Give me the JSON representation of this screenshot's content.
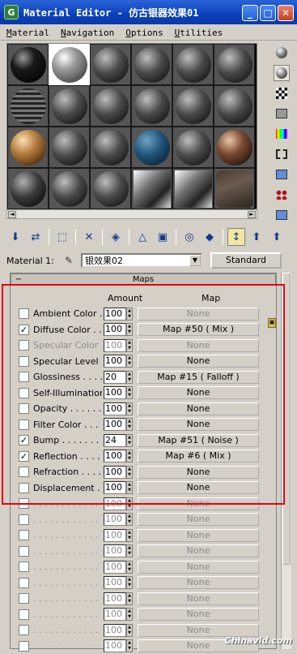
{
  "window": {
    "title": "Material Editor - 仿古银器效果01",
    "app_icon_letter": "G",
    "buttons": {
      "minimize": "_",
      "maximize": "□",
      "close": "✕"
    }
  },
  "menu": [
    "Material",
    "Navigation",
    "Options",
    "Utilities"
  ],
  "slots": [
    "black",
    "chrome",
    "metal",
    "metal",
    "metal",
    "metal",
    "tiles",
    "metal",
    "metal",
    "metal",
    "metal",
    "metal",
    "copper",
    "metal",
    "metal",
    "blue",
    "metal",
    "bronze",
    "env",
    "metal",
    "metal",
    "flat",
    "flat",
    "flatdark"
  ],
  "side_toolbar": [
    "sample-type-icon",
    "backlight-icon",
    "background-icon",
    "sample-uv-tiling-icon",
    "video-color-check-icon",
    "make-preview-icon",
    "options-icon",
    "select-by-material-icon",
    "material-map-navigator-icon"
  ],
  "material_row": {
    "label": "Material 1:",
    "name": "银效果02",
    "type_button": "Standard"
  },
  "maps": {
    "title": "Maps",
    "amount_header": "Amount",
    "map_header": "Map",
    "rows": [
      {
        "label": "Ambient Color . . .",
        "checked": false,
        "amount": "100",
        "map": "None",
        "disabled": false,
        "map_disabled": true
      },
      {
        "label": "Diffuse Color . . . .",
        "checked": true,
        "amount": "100",
        "map": "Map #50  ( Mix )",
        "disabled": false,
        "map_disabled": false
      },
      {
        "label": "Specular Color . . .",
        "checked": false,
        "amount": "100",
        "map": "None",
        "disabled": true,
        "map_disabled": true
      },
      {
        "label": "Specular Level .",
        "checked": false,
        "amount": "100",
        "map": "None",
        "disabled": false,
        "map_disabled": false
      },
      {
        "label": "Glossiness  . . . . .",
        "checked": false,
        "amount": "20",
        "map": "Map #15  ( Falloff )",
        "disabled": false,
        "map_disabled": false
      },
      {
        "label": "Self-Illumination .",
        "checked": false,
        "amount": "100",
        "map": "None",
        "disabled": false,
        "map_disabled": false
      },
      {
        "label": "Opacity  . . . . . . .",
        "checked": false,
        "amount": "100",
        "map": "None",
        "disabled": false,
        "map_disabled": false
      },
      {
        "label": "Filter Color  . . . . .",
        "checked": false,
        "amount": "100",
        "map": "None",
        "disabled": false,
        "map_disabled": false
      },
      {
        "label": "Bump  . . . . . . . . .",
        "checked": true,
        "amount": "24",
        "map": "Map #51  ( Noise )",
        "disabled": false,
        "map_disabled": false
      },
      {
        "label": "Reflection  . . . . .",
        "checked": true,
        "amount": "100",
        "map": "Map #6  ( Mix )",
        "disabled": false,
        "map_disabled": false
      },
      {
        "label": "Refraction  . . . . .",
        "checked": false,
        "amount": "100",
        "map": "None",
        "disabled": false,
        "map_disabled": false
      },
      {
        "label": "Displacement  . . .",
        "checked": false,
        "amount": "100",
        "map": "None",
        "disabled": false,
        "map_disabled": false
      },
      {
        "label": ". . . . . . . . . . . . .",
        "checked": false,
        "amount": "100",
        "map": "None",
        "disabled": true,
        "map_disabled": true
      },
      {
        "label": ". . . . . . . . . . . . .",
        "checked": false,
        "amount": "100",
        "map": "None",
        "disabled": true,
        "map_disabled": true
      },
      {
        "label": ". . . . . . . . . . . . .",
        "checked": false,
        "amount": "100",
        "map": "None",
        "disabled": true,
        "map_disabled": true
      },
      {
        "label": ". . . . . . . . . . . . .",
        "checked": false,
        "amount": "100",
        "map": "None",
        "disabled": true,
        "map_disabled": true
      },
      {
        "label": ". . . . . . . . . . . . .",
        "checked": false,
        "amount": "100",
        "map": "None",
        "disabled": true,
        "map_disabled": true
      },
      {
        "label": ". . . . . . . . . . . . .",
        "checked": false,
        "amount": "100",
        "map": "None",
        "disabled": true,
        "map_disabled": true
      },
      {
        "label": ". . . . . . . . . . . . .",
        "checked": false,
        "amount": "100",
        "map": "None",
        "disabled": true,
        "map_disabled": true
      },
      {
        "label": ". . . . . . . . . . . . .",
        "checked": false,
        "amount": "100",
        "map": "None",
        "disabled": true,
        "map_disabled": true
      },
      {
        "label": ". . . . . . . . . . . . .",
        "checked": false,
        "amount": "100",
        "map": "None",
        "disabled": true,
        "map_disabled": true
      },
      {
        "label": ". . . . . . . . . . . . .",
        "checked": false,
        "amount": "100",
        "map": "None",
        "disabled": true,
        "map_disabled": true
      }
    ]
  },
  "highlight_color": "#e8000b",
  "watermark": "Chinavid.com"
}
